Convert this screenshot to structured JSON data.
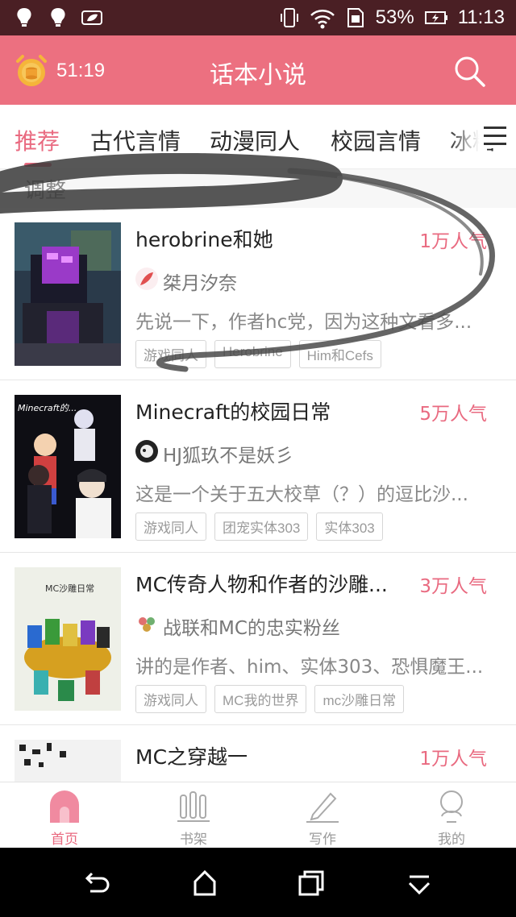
{
  "status_bar": {
    "battery": "53%",
    "time": "11:13"
  },
  "header": {
    "timer": "51:19",
    "title": "话本小说"
  },
  "tabs": [
    {
      "label": "推荐"
    },
    {
      "label": "古代言情"
    },
    {
      "label": "动漫同人"
    },
    {
      "label": "校园言情"
    },
    {
      "label": "冰糖"
    }
  ],
  "hint": {
    "text": "调整"
  },
  "books": [
    {
      "title": "herobrine和她",
      "popularity": "1万人气",
      "author": "桀月汐奈",
      "description": "先说一下，作者hc党，因为这种文看多...",
      "tags": [
        "游戏同人",
        "Herobrine",
        "Him和Cefs"
      ]
    },
    {
      "title": "Minecraft的校园日常",
      "popularity": "5万人气",
      "author": "HJ狐玖不是妖彡",
      "description": "这是一个关于五大校草（？）的逗比沙...",
      "tags": [
        "游戏同人",
        "团宠实体303",
        "实体303"
      ]
    },
    {
      "title": "MC传奇人物和作者的沙雕...",
      "popularity": "3万人气",
      "author": "战联和MC的忠实粉丝",
      "description": "讲的是作者、him、实体303、恐惧魔王...",
      "tags": [
        "游戏同人",
        "MC我的世界",
        "mc沙雕日常"
      ],
      "cover_caption": "MC沙雕日常"
    },
    {
      "title": "MC之穿越一",
      "popularity": "1万人气"
    }
  ],
  "bottom_nav": [
    {
      "label": "首页"
    },
    {
      "label": "书架"
    },
    {
      "label": "写作"
    },
    {
      "label": "我的"
    }
  ],
  "colors": {
    "accent": "#e96a80",
    "header": "#ec7080",
    "status_bar": "#4a1f24"
  },
  "cover_2_caption": "Minecraft的..."
}
